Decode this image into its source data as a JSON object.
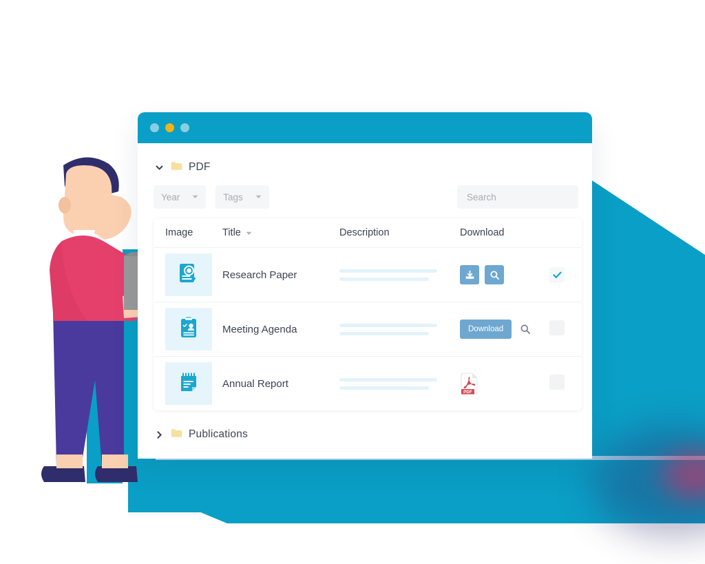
{
  "window": {
    "dots": [
      "blue",
      "amber",
      "blue"
    ],
    "title_bar_color": "#0a9fc6"
  },
  "folder": {
    "chevron": "chevron-down",
    "label": "PDF"
  },
  "filters": {
    "year": {
      "label": "Year",
      "caret": "caret-down"
    },
    "tags": {
      "label": "Tags",
      "caret": "caret-down"
    }
  },
  "search": {
    "value": "",
    "placeholder": "Search"
  },
  "table": {
    "columns": [
      {
        "key": "image",
        "label": "Image",
        "sortable": false
      },
      {
        "key": "title",
        "label": "Title",
        "sortable": true
      },
      {
        "key": "description",
        "label": "Description",
        "sortable": false
      },
      {
        "key": "download",
        "label": "Download",
        "sortable": false
      }
    ],
    "rows": [
      {
        "icon": "document-magnifier-icon",
        "title": "Research Paper",
        "description_lines": 2,
        "download_style": "icon-buttons",
        "download_buttons": [
          "download-tray-icon",
          "search-icon"
        ],
        "checked": true
      },
      {
        "icon": "clipboard-person-icon",
        "title": "Meeting Agenda",
        "description_lines": 2,
        "download_style": "text-button",
        "download_label": "Download",
        "download_buttons": [
          "search-icon"
        ],
        "checked": false
      },
      {
        "icon": "notepad-icon",
        "title": "Annual Report",
        "description_lines": 2,
        "download_style": "pdf-file-icon",
        "pdf_badge": "PDF",
        "checked": false
      }
    ]
  },
  "publications": {
    "chevron": "chevron-right",
    "label": "Publications"
  },
  "colors": {
    "brand_cyan": "#0a9fc6",
    "accent_blue": "#6ea7d0",
    "check_cyan": "#16a5d4",
    "thumb_bg": "#e6f5fb",
    "pdf_red": "#d24a52",
    "folder_yellow": "#f7dfa0",
    "sweater_pink": "#e5406c",
    "trouser_purple": "#4a3a9e",
    "hair_navy": "#2f2d6b",
    "skin": "#fbd0b0"
  }
}
